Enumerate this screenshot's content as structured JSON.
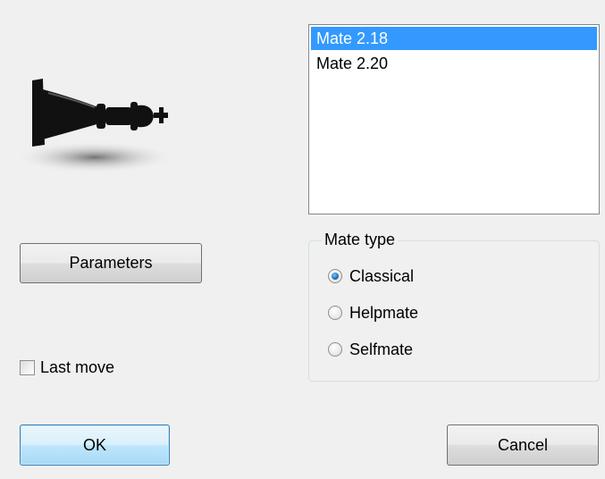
{
  "versions": {
    "items": [
      "Mate 2.18",
      "Mate 2.20"
    ],
    "selected_index": 0
  },
  "parameters_button": {
    "label": "Parameters"
  },
  "mate_type": {
    "legend": "Mate type",
    "options": [
      "Classical",
      "Helpmate",
      "Selfmate"
    ],
    "selected": "Classical"
  },
  "last_move": {
    "label": "Last move",
    "checked": false
  },
  "ok_button": {
    "label": "OK"
  },
  "cancel_button": {
    "label": "Cancel"
  },
  "colors": {
    "selection": "#3399ff",
    "default_button_border": "#3c7fb1"
  }
}
